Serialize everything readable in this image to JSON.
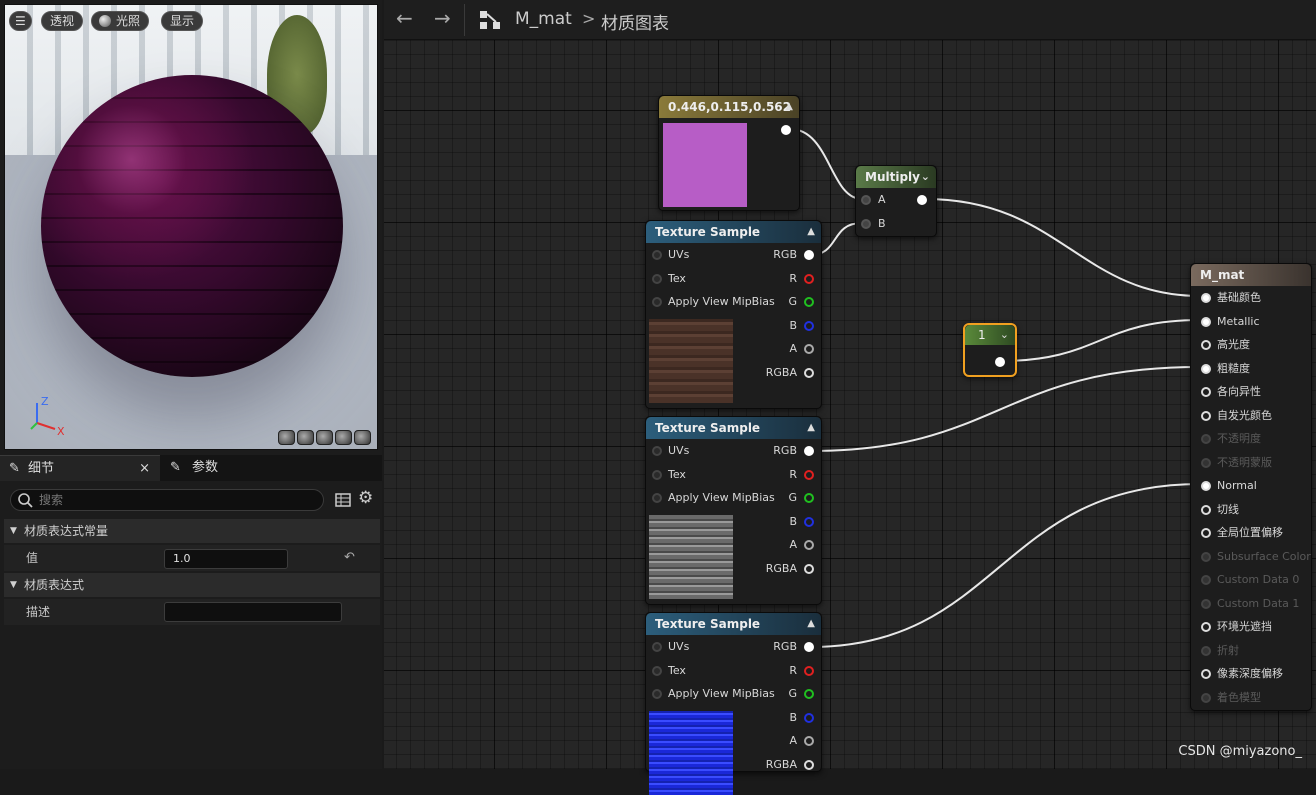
{
  "viewport": {
    "buttons": {
      "menu": "☰",
      "perspective": "透视",
      "lighting": "光照",
      "show": "显示"
    },
    "axis": {
      "x": "X",
      "z": "Z"
    }
  },
  "details": {
    "tab_details": "细节",
    "tab_params": "参数",
    "close": "×",
    "search_placeholder": "搜索",
    "section_constant": "材质表达式常量",
    "value_label": "值",
    "value": "1.0",
    "section_expression": "材质表达式",
    "desc_label": "描述",
    "desc_value": ""
  },
  "toolbar": {
    "back": "←",
    "forward": "→",
    "asset": "M_mat",
    "separator": ">",
    "graph": "材质图表"
  },
  "nodes": {
    "color_const": {
      "title": "0.446,0.115,0.562",
      "swatch": "#b75dc6"
    },
    "multiply": {
      "title": "Multiply",
      "pin_a": "A",
      "pin_b": "B"
    },
    "tex1": {
      "title": "Texture Sample",
      "preview": "wood"
    },
    "tex2": {
      "title": "Texture Sample",
      "preview": "stone"
    },
    "tex3": {
      "title": "Texture Sample",
      "preview": "normal"
    },
    "tex_pins_in": [
      "UVs",
      "Tex",
      "Apply View MipBias"
    ],
    "tex_pins_out": [
      "RGB",
      "R",
      "G",
      "B",
      "A",
      "RGBA"
    ],
    "scalar": {
      "title": "1"
    },
    "material": {
      "title": "M_mat",
      "inputs": [
        {
          "label": "基础颜色",
          "enabled": true,
          "connected": true
        },
        {
          "label": "Metallic",
          "enabled": true,
          "connected": true
        },
        {
          "label": "高光度",
          "enabled": true,
          "connected": false
        },
        {
          "label": "粗糙度",
          "enabled": true,
          "connected": true
        },
        {
          "label": "各向异性",
          "enabled": true,
          "connected": false
        },
        {
          "label": "自发光颜色",
          "enabled": true,
          "connected": false
        },
        {
          "label": "不透明度",
          "enabled": false,
          "connected": false
        },
        {
          "label": "不透明蒙版",
          "enabled": false,
          "connected": false
        },
        {
          "label": "Normal",
          "enabled": true,
          "connected": true
        },
        {
          "label": "切线",
          "enabled": true,
          "connected": false
        },
        {
          "label": "全局位置偏移",
          "enabled": true,
          "connected": false
        },
        {
          "label": "Subsurface Color",
          "enabled": false,
          "connected": false
        },
        {
          "label": "Custom Data 0",
          "enabled": false,
          "connected": false
        },
        {
          "label": "Custom Data 1",
          "enabled": false,
          "connected": false
        },
        {
          "label": "环境光遮挡",
          "enabled": true,
          "connected": false
        },
        {
          "label": "折射",
          "enabled": false,
          "connected": false
        },
        {
          "label": "像素深度偏移",
          "enabled": true,
          "connected": false
        },
        {
          "label": "着色模型",
          "enabled": false,
          "connected": false
        }
      ]
    }
  },
  "watermark": "CSDN @miyazono_",
  "colors": {
    "const_header": "#8a7a3a",
    "multiply_header": "#4f6a3e",
    "texture_header": "#2c5e7c",
    "material_header": "#7a6a5e",
    "scalar_border": "#f0a020"
  }
}
